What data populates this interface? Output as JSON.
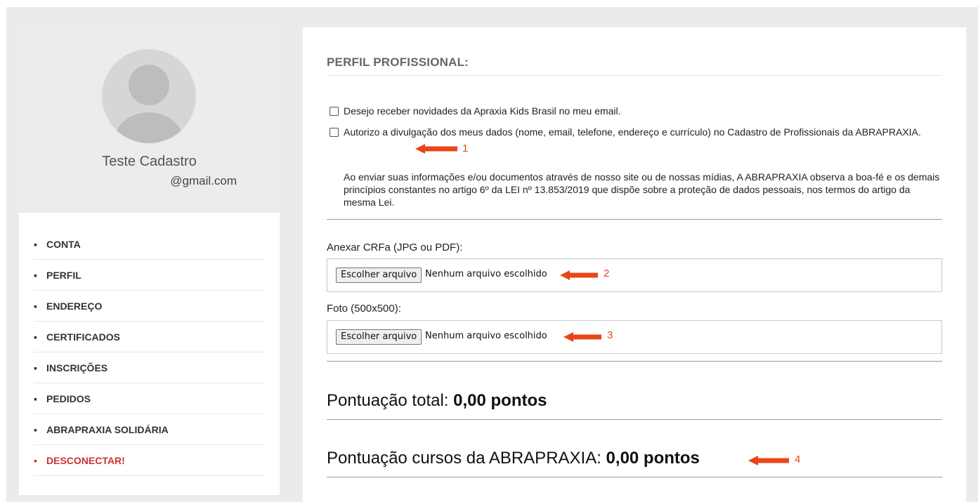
{
  "profile": {
    "name": "Teste Cadastro",
    "email": "@gmail.com"
  },
  "menu": {
    "bullet": "▪",
    "items": [
      {
        "label": "CONTA"
      },
      {
        "label": "PERFIL"
      },
      {
        "label": "ENDEREÇO"
      },
      {
        "label": "CERTIFICADOS"
      },
      {
        "label": "INSCRIÇÕES"
      },
      {
        "label": "PEDIDOS"
      },
      {
        "label": "ABRAPRAXIA SOLIDÁRIA"
      },
      {
        "label": "DESCONECTAR!"
      }
    ]
  },
  "main": {
    "section_title": "PERFIL PROFISSIONAL:",
    "checkbox_news": {
      "label": "Desejo receber novidades da Apraxia Kids Brasil no meu email.",
      "checked": false
    },
    "checkbox_consent": {
      "label": "Autorizo a divulgação dos meus dados (nome, email, telefone, endereço e currículo) no Cadastro de Profissionais da ABRAPRAXIA.",
      "checked": false
    },
    "notice": "Ao enviar suas informações e/ou documentos através de nosso site ou de nossas mídias, A ABRAPRAXIA observa a boa-fé e os demais princípios constantes no artigo 6º da LEI nº 13.853/2019 que dispõe sobre a proteção de dados pessoais, nos termos do artigo da mesma Lei.",
    "crfa": {
      "label": "Anexar CRFa (JPG ou PDF):",
      "button": "Escolher arquivo",
      "status": "Nenhum arquivo escolhido"
    },
    "foto": {
      "label": "Foto (500x500):",
      "button": "Escolher arquivo",
      "status": "Nenhum arquivo escolhido"
    },
    "score_total": {
      "label": "Pontuação total: ",
      "value": "0,00 pontos"
    },
    "score_courses": {
      "label": "Pontuação cursos da ABRAPRAXIA: ",
      "value": "0,00 pontos"
    }
  },
  "annotations": {
    "color": "#e8461a",
    "numbers": [
      "1",
      "2",
      "3",
      "4"
    ]
  },
  "colors": {
    "logout": "#c9342d",
    "background": "#ebebeb"
  }
}
